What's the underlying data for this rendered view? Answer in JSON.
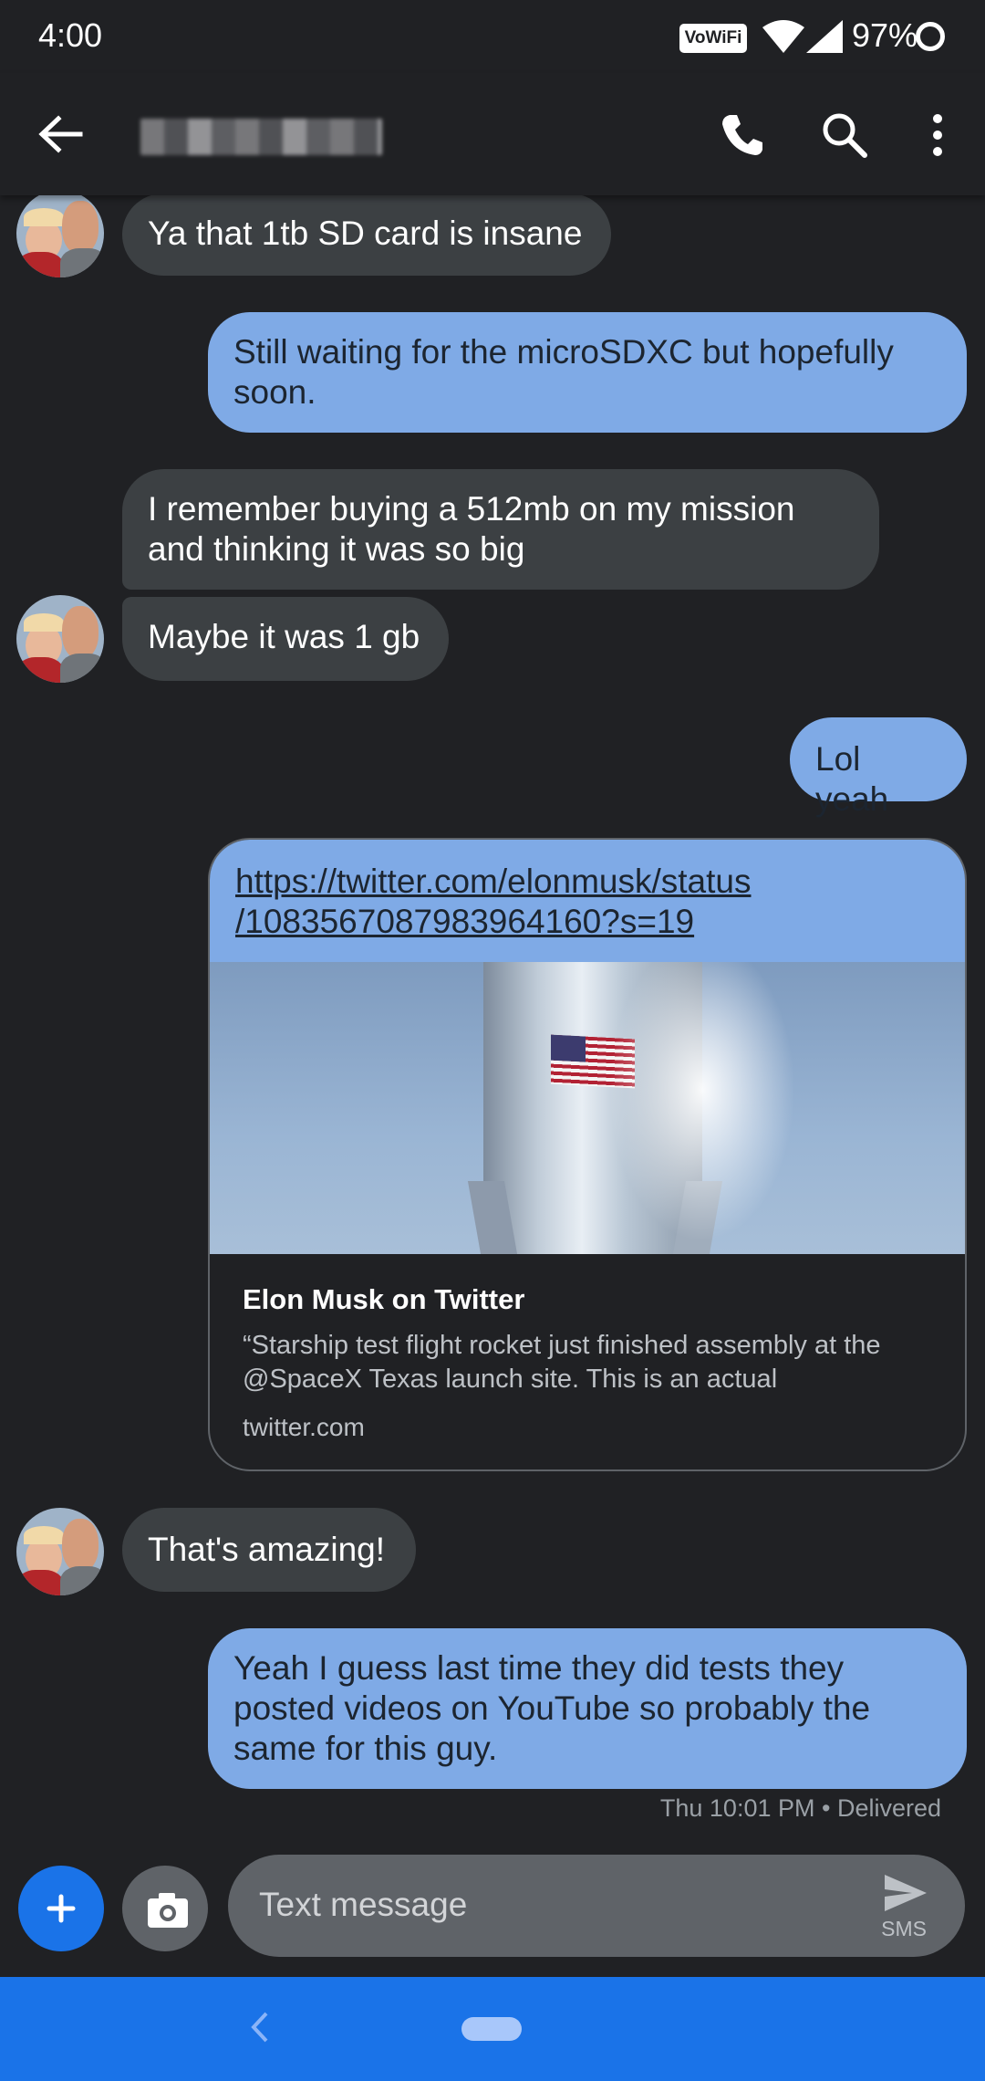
{
  "status_bar": {
    "time": "4:00",
    "vowifi": "VoWiFi",
    "battery": "97%"
  },
  "app_bar": {
    "contact_name": "(redacted)"
  },
  "messages": [
    {
      "direction": "incoming",
      "text": "Ya that 1tb SD card is insane"
    },
    {
      "direction": "outgoing",
      "text": "Still waiting for the microSDXC but hopefully soon."
    },
    {
      "direction": "incoming",
      "text": "I remember buying a 512mb on my mission and thinking it was so big"
    },
    {
      "direction": "incoming",
      "text": "Maybe it was 1 gb"
    },
    {
      "direction": "outgoing",
      "text": "Lol yeah"
    },
    {
      "direction": "outgoing",
      "text": "https://twitter.com/elonmusk/status/1083567087983964160?s=19"
    },
    {
      "direction": "incoming",
      "text": "That's amazing!"
    },
    {
      "direction": "outgoing",
      "text": "Yeah I guess last time they did tests they posted videos on YouTube so probably the same for this guy."
    }
  ],
  "link_preview": {
    "url_line1": "https://twitter.com/elonmusk/status",
    "url_line2": "/1083567087983964160?s=19",
    "title": "Elon Musk on Twitter",
    "description": "“Starship test flight rocket just finished assembly at the @SpaceX Texas launch site. This is an actual",
    "domain": "twitter.com"
  },
  "message_status": "Thu 10:01 PM • Delivered",
  "compose": {
    "placeholder": "Text message",
    "send_label": "SMS"
  },
  "colors": {
    "background": "#202124",
    "incoming_bubble": "#3c4043",
    "outgoing_bubble": "#7faae6",
    "accent": "#1a73e8"
  }
}
